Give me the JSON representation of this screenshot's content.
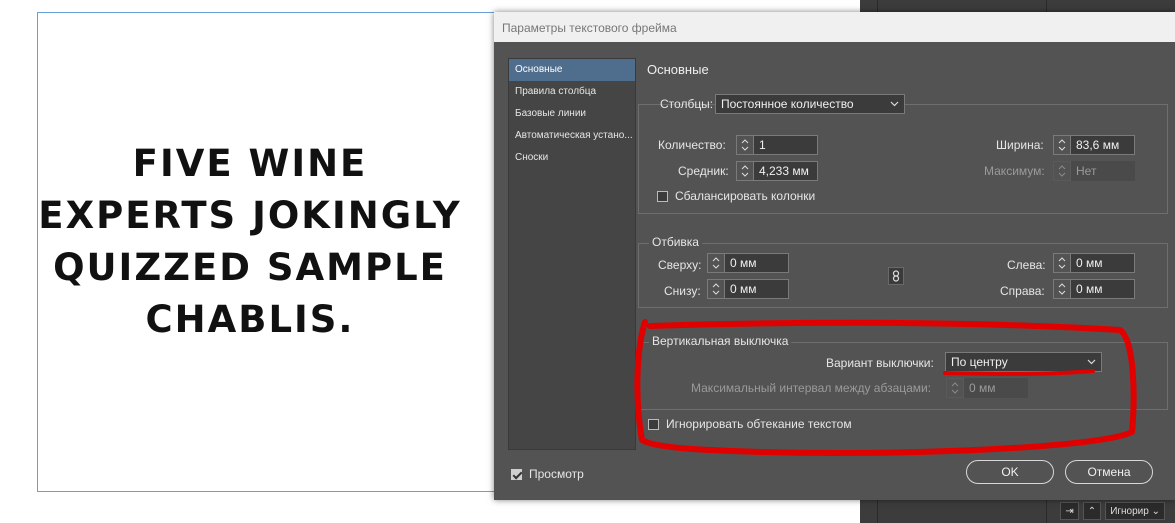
{
  "document": {
    "sample_text_lines": [
      "Five wine",
      "experts jokingly",
      "quizzed sample",
      "Chablis."
    ]
  },
  "dialog": {
    "title": "Параметры текстового фрейма",
    "nav": [
      {
        "label": "Основные",
        "active": true
      },
      {
        "label": "Правила столбца",
        "active": false
      },
      {
        "label": "Базовые линии",
        "active": false
      },
      {
        "label": "Автоматическая устано...",
        "active": false
      },
      {
        "label": "Сноски",
        "active": false
      }
    ],
    "section_title": "Основные",
    "columns": {
      "label": "Столбцы:",
      "mode_value": "Постоянное количество",
      "count_label": "Количество:",
      "count_value": "1",
      "gutter_label": "Средник:",
      "gutter_value": "4,233 мм",
      "width_label": "Ширина:",
      "width_value": "83,6 мм",
      "max_label": "Максимум:",
      "max_value": "Нет",
      "balance_label": "Сбалансировать колонки",
      "balance_checked": false
    },
    "inset": {
      "label": "Отбивка",
      "top_label": "Сверху:",
      "top_value": "0 мм",
      "bottom_label": "Снизу:",
      "bottom_value": "0 мм",
      "left_label": "Слева:",
      "left_value": "0 мм",
      "right_label": "Справа:",
      "right_value": "0 мм"
    },
    "vertical_justification": {
      "label": "Вертикальная выключка",
      "align_label": "Вариант выключки:",
      "align_value": "По центру",
      "spacing_label": "Максимальный интервал между абзацами:",
      "spacing_value": "0 мм"
    },
    "ignore_wrap_label": "Игнорировать обтекание текстом",
    "ignore_wrap_checked": false,
    "preview_label": "Просмотр",
    "preview_checked": true,
    "ok_label": "OK",
    "cancel_label": "Отмена"
  },
  "right_panel": {
    "ignore_select": "Игнорир"
  },
  "colors": {
    "annotation": "#e00000",
    "nav_active": "#4f6d8c",
    "dialog_bg": "#535353"
  }
}
